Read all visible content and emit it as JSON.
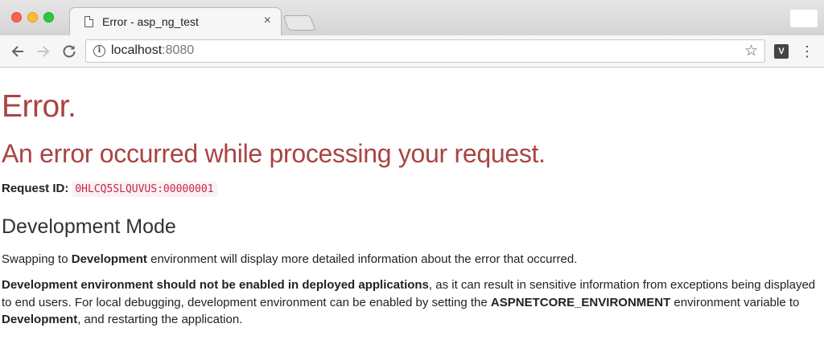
{
  "browser": {
    "tab_title": "Error - asp_ng_test",
    "tab_close": "×",
    "url_host": "localhost",
    "url_port": ":8080",
    "ext_label": "V",
    "icons": {
      "doc": "document-icon",
      "back": "back-arrow-icon",
      "forward": "forward-arrow-icon",
      "reload": "reload-icon",
      "info": "info-icon",
      "star": "star-icon",
      "extension": "extension-icon",
      "menu": "kebab-menu-icon"
    }
  },
  "page": {
    "heading": "Error.",
    "subheading": "An error occurred while processing your request.",
    "request_id_label": "Request ID:",
    "request_id_value": "0HLCQ5SLQUVUS:00000001",
    "dev_heading": "Development Mode",
    "p1": {
      "a": "Swapping to ",
      "b": "Development",
      "c": " environment will display more detailed information about the error that occurred."
    },
    "p2": {
      "a": "Development environment should not be enabled in deployed applications",
      "b": ", as it can result in sensitive information from exceptions being displayed to end users. For local debugging, development environment can be enabled by setting the ",
      "c": "ASPNETCORE_ENVIRONMENT",
      "d": " environment variable to ",
      "e": "Development",
      "f": ", and restarting the application."
    }
  },
  "colors": {
    "error_red": "#a94442",
    "code_red": "#c7254e"
  }
}
